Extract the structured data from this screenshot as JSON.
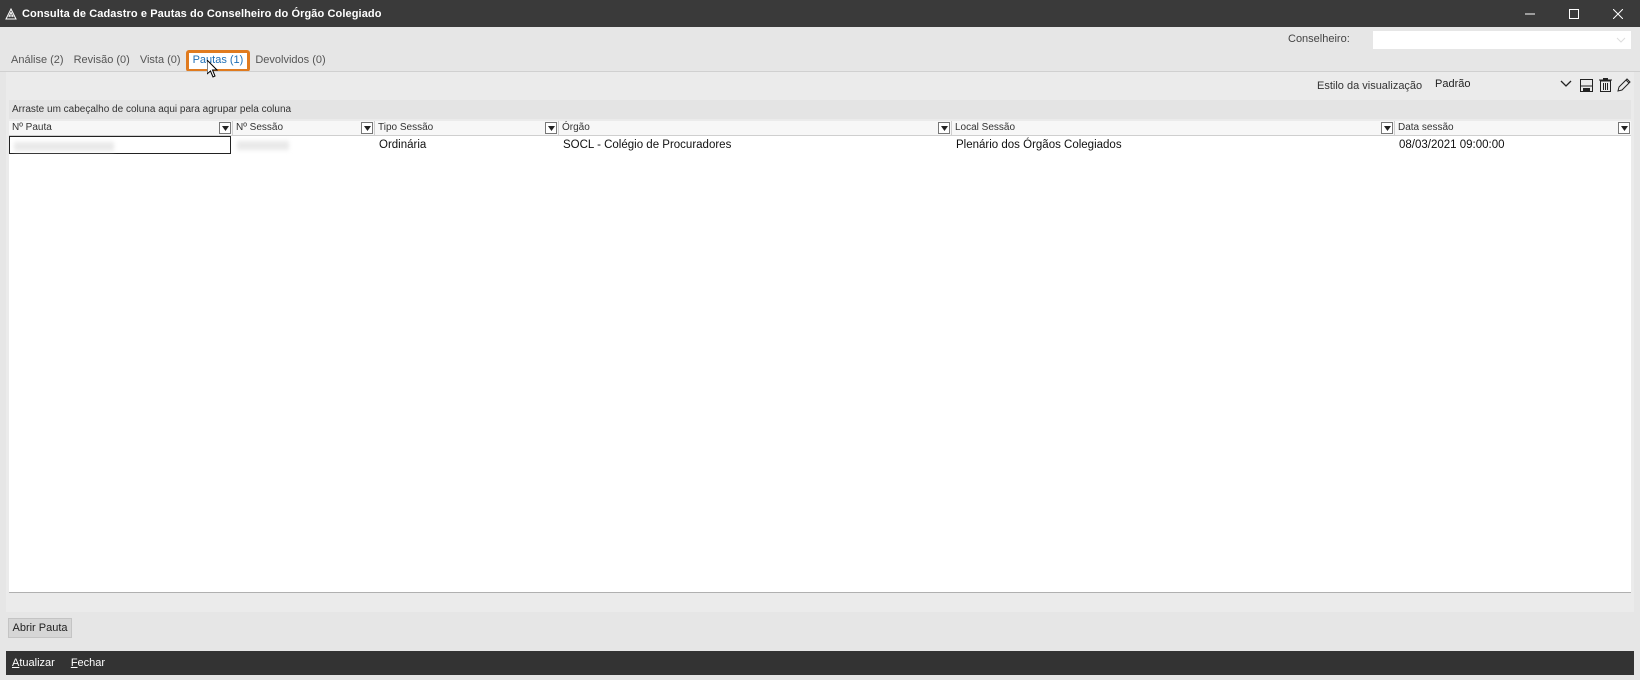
{
  "window": {
    "title": "Consulta de Cadastro e Pautas do Conselheiro do Órgão Colegiado",
    "minimize": "—",
    "maximize": "☐",
    "close": "✕"
  },
  "filter": {
    "conselheiro_label": "Conselheiro:",
    "conselheiro_value": ""
  },
  "tabs": [
    {
      "label": "Análise (2)"
    },
    {
      "label": "Revisão (0)"
    },
    {
      "label": "Vista (0)"
    },
    {
      "label": "Pautas (1)",
      "active": true
    },
    {
      "label": "Devolvidos (0)"
    }
  ],
  "toolbar": {
    "style_label": "Estilo da visualização",
    "style_value": "Padrão"
  },
  "grid": {
    "group_hint": "Arraste um cabeçalho de coluna aqui para agrupar pela coluna",
    "columns": [
      "Nº Pauta",
      "Nº Sessão",
      "Tipo Sessão",
      "Órgão",
      "Local Sessão",
      "Data sessão"
    ],
    "rows": [
      {
        "tipo_sessao": "Ordinária",
        "orgao": "SOCL - Colégio de Procuradores",
        "local_sessao": "Plenário dos Órgãos Colegiados",
        "data_sessao": "08/03/2021 09:00:00"
      }
    ]
  },
  "buttons": {
    "abrir_pauta": "Abrir Pauta",
    "atualizar_first": "A",
    "atualizar_rest": "tualizar",
    "fechar_first": "F",
    "fechar_rest": "echar"
  },
  "colors": {
    "titlebar": "#3a3a3a",
    "active_tab_border": "#e07b1f",
    "active_tab_text": "#1f6fb5"
  }
}
